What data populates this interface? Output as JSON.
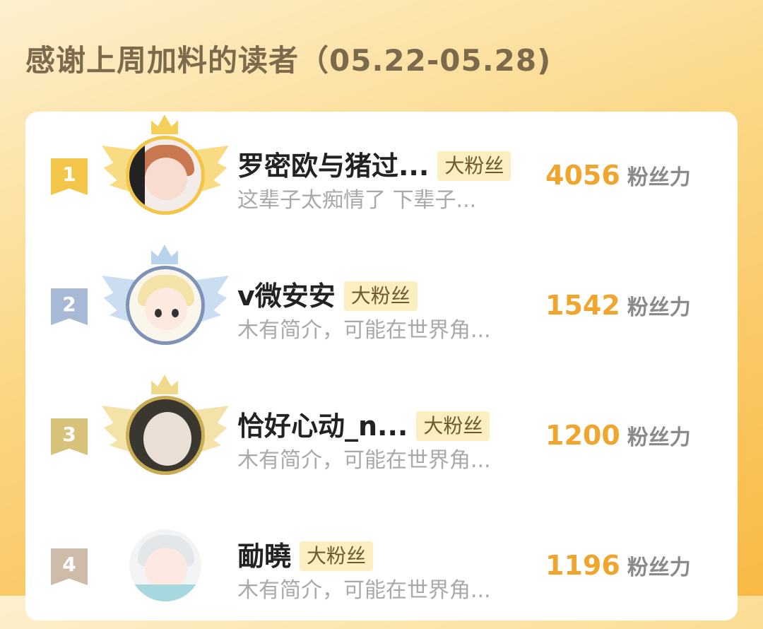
{
  "header": {
    "title": "感谢上周加料的读者（05.22-05.28)"
  },
  "leaderboard": [
    {
      "rank": "1",
      "name": "罗密欧与猪过...",
      "badge": "大粉丝",
      "bio": "这辈子太痴情了 下辈子...",
      "score": "4056",
      "unit": "粉丝力",
      "rank_color": "#f3c64a",
      "ring_color": "#f3c64a",
      "avatar_icon": "anime-boy-avatar"
    },
    {
      "rank": "2",
      "name": "v微安安",
      "badge": "大粉丝",
      "bio": "木有简介，可能在世界角...",
      "score": "1542",
      "unit": "粉丝力",
      "rank_color": "#a8b9d6",
      "ring_color": "#7f93b8",
      "avatar_icon": "anime-girl-avatar"
    },
    {
      "rank": "3",
      "name": "恰好心动_n...",
      "badge": "大粉丝",
      "bio": "木有简介，可能在世界角...",
      "score": "1200",
      "unit": "粉丝力",
      "rank_color": "#d7c27a",
      "ring_color": "#c9ad55",
      "avatar_icon": "cat-avatar"
    },
    {
      "rank": "4",
      "name": "勔曉",
      "badge": "大粉丝",
      "bio": "木有简介，可能在世界角...",
      "score": "1196",
      "unit": "粉丝力",
      "rank_color": "#cdbcaa",
      "ring_color": "#ffffff",
      "avatar_icon": "anime-child-avatar"
    }
  ]
}
